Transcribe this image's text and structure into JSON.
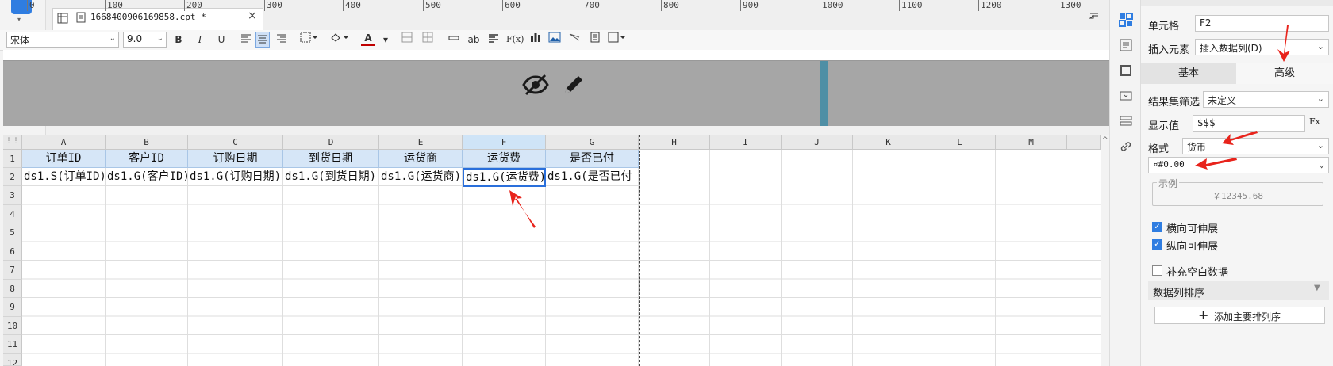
{
  "tab": {
    "label": "1668400906169858.cpt *",
    "close": "×"
  },
  "toolbar": {
    "font_family": "宋体",
    "font_size": "9.0",
    "bold": "B",
    "italic": "I",
    "underline": "U",
    "text_ab": "ab",
    "formula": "F(x)"
  },
  "ruler": {
    "ticks": [
      "0",
      "100",
      "200",
      "300",
      "400",
      "500",
      "600",
      "700",
      "800",
      "900",
      "1000",
      "1100",
      "1200",
      "1300"
    ]
  },
  "grid": {
    "columns": [
      "A",
      "B",
      "C",
      "D",
      "E",
      "F",
      "G",
      "H",
      "I",
      "J",
      "K",
      "L",
      "M"
    ],
    "rows": [
      "1",
      "2",
      "3",
      "4",
      "5",
      "6",
      "7",
      "8",
      "9",
      "10",
      "11",
      "12"
    ],
    "header_cells": [
      "订单ID",
      "客户ID",
      "订购日期",
      "到货日期",
      "运货商",
      "运货费",
      "是否已付"
    ],
    "bind_cells": [
      "ds1.S(订单ID)",
      "ds1.G(客户ID)",
      "ds1.G(订购日期)",
      "ds1.G(到货日期)",
      "ds1.G(运货商)",
      "ds1.G(运货费)",
      "ds1.G(是否已付"
    ]
  },
  "props": {
    "cell_label": "单元格",
    "cell_value": "F2",
    "insert_label": "插入元素",
    "insert_value": "插入数据列(D)",
    "tab_basic": "基本",
    "tab_advanced": "高级",
    "filter_label": "结果集筛选",
    "filter_value": "未定义",
    "display_label": "显示值",
    "display_value": "$$$",
    "display_fx": "Fx",
    "format_label": "格式",
    "format_value": "货币",
    "format_pattern": "¤#0.00",
    "example_label": "示例",
    "example_value": "￥12345.68",
    "h_expand": "横向可伸展",
    "v_expand": "纵向可伸展",
    "fill_blank": "补充空白数据",
    "sort_section": "数据列排序",
    "add_sort": "添加主要排列序"
  },
  "colors": {
    "accent": "#2f7de1",
    "arrow": "#e8231b",
    "header_fill": "#d6e6f7"
  }
}
